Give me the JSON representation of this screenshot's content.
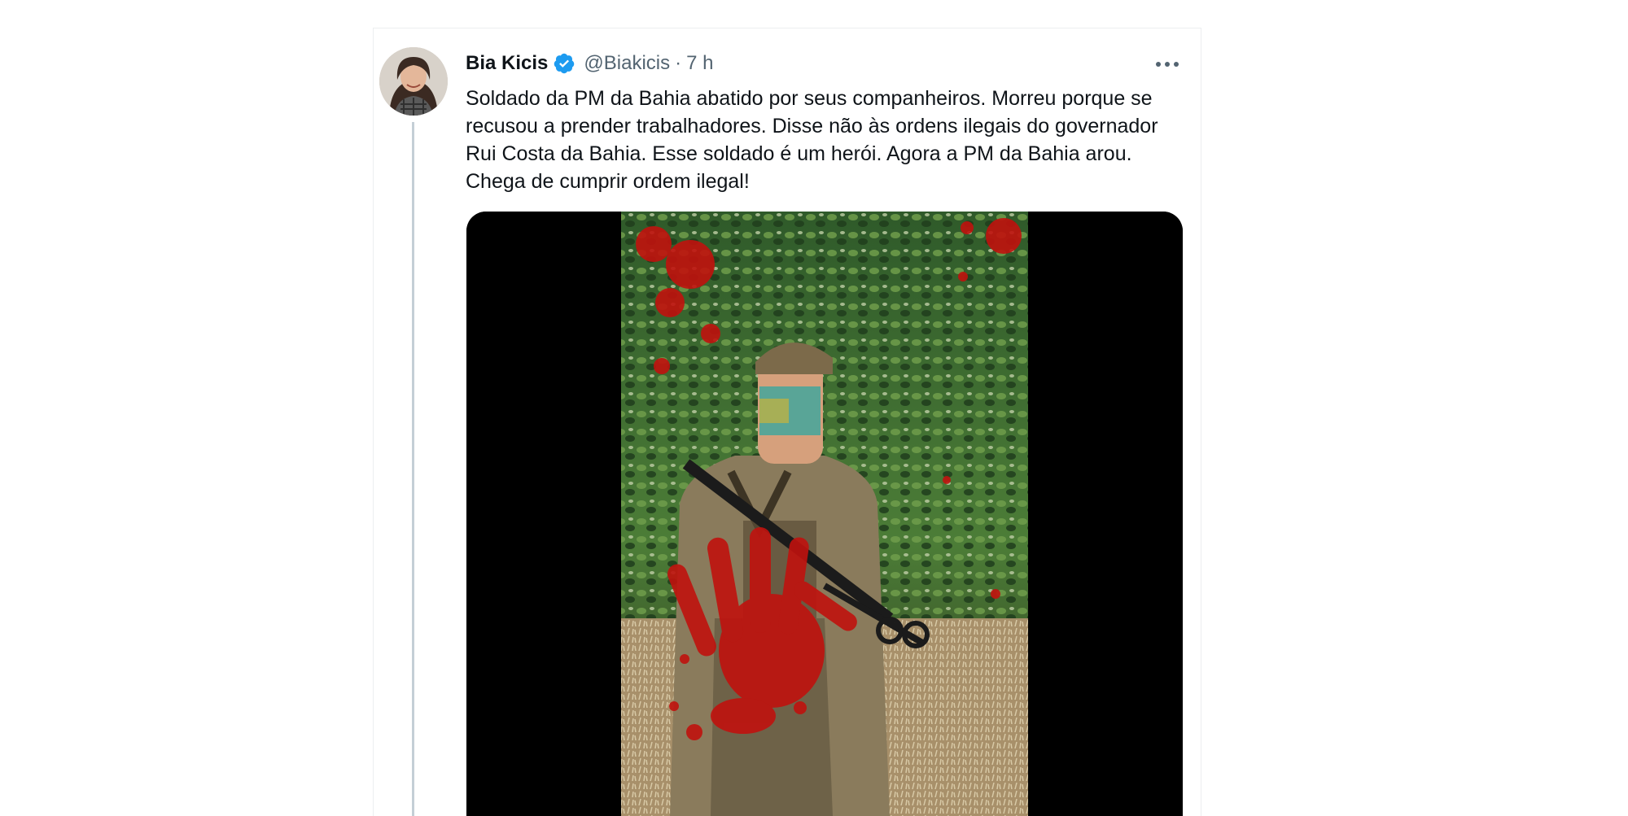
{
  "tweet": {
    "display_name": "Bia Kicis",
    "handle": "@Biakicis",
    "separator": "·",
    "time": "7 h",
    "verified_icon": "verified-badge-icon",
    "more_icon": "more-options-icon",
    "text": "Soldado da PM da Bahia abatido por seus companheiros. Morreu porque se recusou a prender trabalhadores. Disse não às ordens ilegais do governador Rui Costa da Bahia. Esse soldado é um herói. Agora a PM da Bahia arou. Chega de cumprir ordem ilegal!"
  },
  "colors": {
    "accent": "#1d9bf0",
    "text_primary": "#0f1419",
    "text_secondary": "#536471",
    "media_background": "#000000"
  }
}
